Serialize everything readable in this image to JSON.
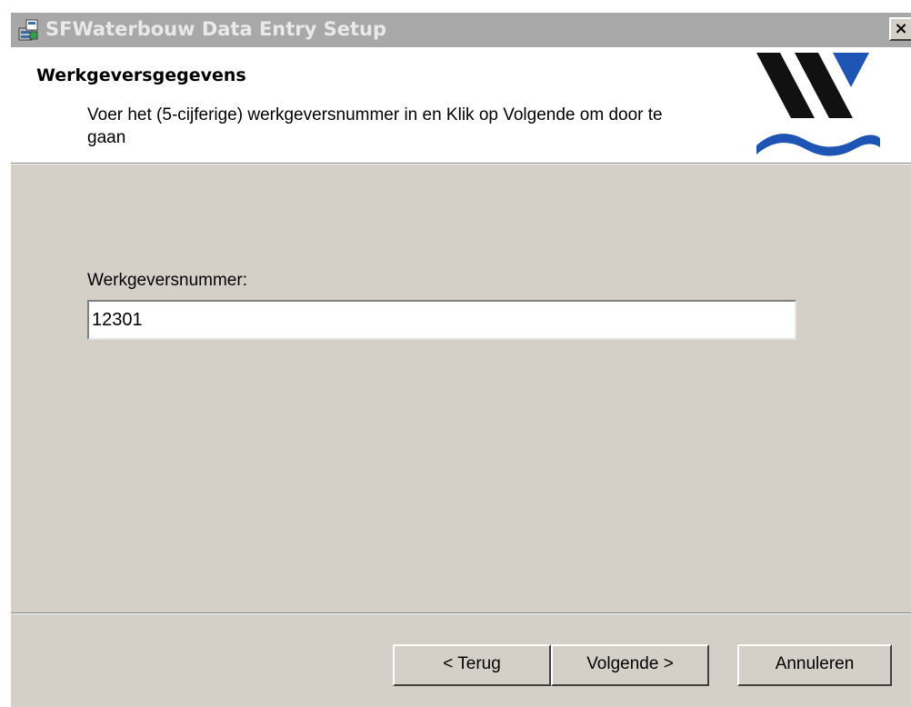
{
  "window": {
    "title": "SFWaterbouw Data Entry Setup",
    "close_label": "×"
  },
  "banner": {
    "title": "Werkgeversgegevens",
    "description": "Voer het (5-cijferige) werkgeversnummer in en Klik op Volgende om door te gaan"
  },
  "form": {
    "employer_number_label": "Werkgeversnummer:",
    "employer_number_value": "12301"
  },
  "footer": {
    "back_label": "< Terug",
    "next_label": "Volgende >",
    "cancel_label": "Annuleren"
  },
  "colors": {
    "dialog_background": "#d4d0c8",
    "titlebar_inactive": "#a8a8a8",
    "logo_black": "#111111",
    "logo_blue": "#1e54b4"
  },
  "icons": {
    "title_icon": "setup-installer-icon",
    "logo": "sfwaterbouw-logo"
  }
}
